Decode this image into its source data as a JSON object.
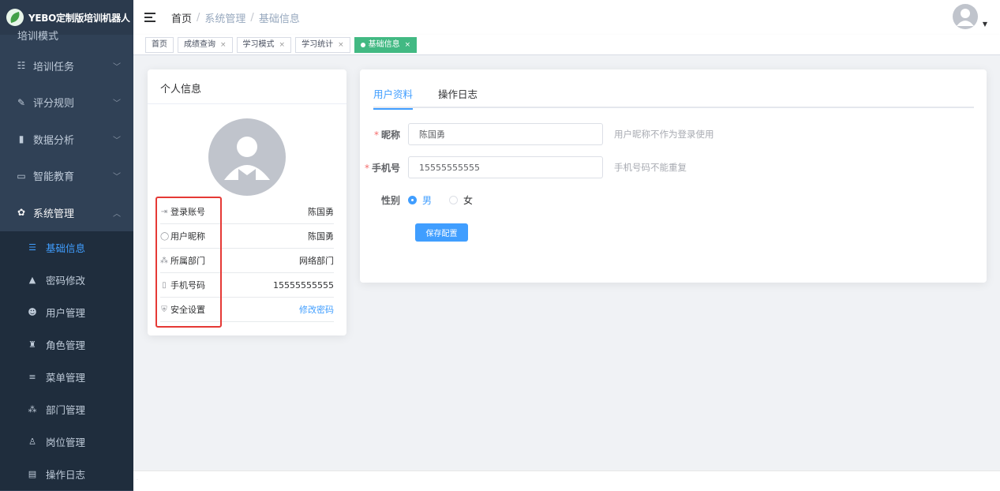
{
  "app": {
    "title": "YEBO定制版培训机器人"
  },
  "sidebar": {
    "cut_item": "培训模式",
    "menus": [
      {
        "label": "培训任务",
        "icon": "list-icon",
        "glyph": "☷"
      },
      {
        "label": "评分规则",
        "icon": "edit-icon",
        "glyph": "✎"
      },
      {
        "label": "数据分析",
        "icon": "bar-chart-icon",
        "glyph": "▮"
      },
      {
        "label": "智能教育",
        "icon": "monitor-icon",
        "glyph": "▭"
      },
      {
        "label": "系统管理",
        "icon": "gear-icon",
        "glyph": "✿"
      }
    ],
    "submenu": [
      {
        "label": "基础信息",
        "icon": "chat-icon",
        "glyph": "☰",
        "active": true
      },
      {
        "label": "密码修改",
        "icon": "lock-icon",
        "glyph": "▲"
      },
      {
        "label": "用户管理",
        "icon": "users-icon",
        "glyph": "☻"
      },
      {
        "label": "角色管理",
        "icon": "role-icon",
        "glyph": "♜"
      },
      {
        "label": "菜单管理",
        "icon": "menu-icon",
        "glyph": "≡"
      },
      {
        "label": "部门管理",
        "icon": "tree-icon",
        "glyph": "⁂"
      },
      {
        "label": "岗位管理",
        "icon": "post-icon",
        "glyph": "♙"
      },
      {
        "label": "操作日志",
        "icon": "log-icon",
        "glyph": "▤"
      }
    ]
  },
  "breadcrumb": {
    "items": [
      "首页",
      "系统管理",
      "基础信息"
    ],
    "sep": "/"
  },
  "tags": [
    {
      "label": "首页",
      "closable": false
    },
    {
      "label": "成绩查询",
      "closable": true
    },
    {
      "label": "学习模式",
      "closable": true
    },
    {
      "label": "学习统计",
      "closable": true
    },
    {
      "label": "基础信息",
      "closable": true,
      "active": true
    }
  ],
  "profile_card": {
    "title": "个人信息",
    "rows": [
      {
        "label": "登录账号",
        "value": "陈国勇",
        "icon": "login-icon",
        "glyph": "⇥"
      },
      {
        "label": "用户昵称",
        "value": "陈国勇",
        "icon": "user-circle-icon",
        "glyph": "◯"
      },
      {
        "label": "所属部门",
        "value": "网络部门",
        "icon": "tree-icon",
        "glyph": "⁂"
      },
      {
        "label": "手机号码",
        "value": "15555555555",
        "icon": "phone-icon",
        "glyph": "▯"
      },
      {
        "label": "安全设置",
        "value": "修改密码",
        "icon": "shield-icon",
        "glyph": "⛨",
        "link": true
      }
    ]
  },
  "form": {
    "tabs": [
      "用户资料",
      "操作日志"
    ],
    "nickname": {
      "label": "昵称",
      "value": "陈国勇",
      "hint": "用户昵称不作为登录使用"
    },
    "phone": {
      "label": "手机号",
      "value": "15555555555",
      "hint": "手机号码不能重复"
    },
    "gender": {
      "label": "性别",
      "options": [
        "男",
        "女"
      ],
      "selected": 0
    },
    "save_label": "保存配置"
  },
  "colors": {
    "sidebar": "#304156",
    "accent": "#409eff",
    "tag_active": "#42b983",
    "highlight": "#e53935"
  }
}
